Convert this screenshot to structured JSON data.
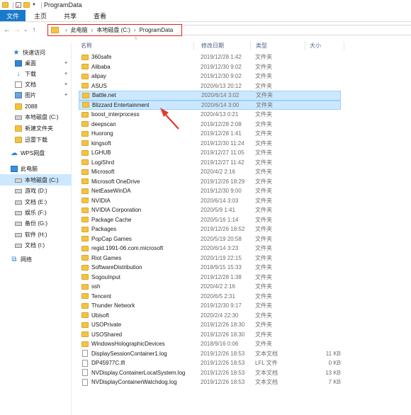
{
  "window": {
    "title": "ProgramData"
  },
  "ribbon": {
    "tabs": [
      "文件",
      "主页",
      "共享",
      "查看"
    ]
  },
  "address": {
    "crumbs": [
      "此电脑",
      "本地磁盘 (C:)",
      "ProgramData"
    ]
  },
  "columns": {
    "name": "名称",
    "date": "修改日期",
    "type": "类型",
    "size": "大小"
  },
  "sidebar": {
    "quick_access": "快速访问",
    "items": [
      {
        "label": "桌面",
        "icon": "desktop-icon",
        "pinned": true
      },
      {
        "label": "下载",
        "icon": "download-icon",
        "pinned": true
      },
      {
        "label": "文档",
        "icon": "document-icon",
        "pinned": true
      },
      {
        "label": "图片",
        "icon": "picture-icon",
        "pinned": true
      },
      {
        "label": "2088",
        "icon": "folder-icon"
      },
      {
        "label": "本地磁盘 (C:)",
        "icon": "drive-icon"
      },
      {
        "label": "新建文件夹",
        "icon": "folder-icon"
      },
      {
        "label": "迅雷下载",
        "icon": "folder-icon"
      }
    ],
    "wps": "WPS网盘",
    "this_pc": "此电脑",
    "drives": [
      {
        "label": "本地磁盘 (C:)",
        "selected": true
      },
      {
        "label": "游戏 (D:)"
      },
      {
        "label": "文档 (E:)"
      },
      {
        "label": "娱乐 (F:)"
      },
      {
        "label": "备份 (G:)"
      },
      {
        "label": "软件 (H:)"
      },
      {
        "label": "文档 (I:)"
      }
    ],
    "network": "网络"
  },
  "files": [
    {
      "name": "360safe",
      "date": "2019/12/28 1:42",
      "type": "文件夹",
      "size": "",
      "kind": "folder"
    },
    {
      "name": "Alibaba",
      "date": "2019/12/30 9:02",
      "type": "文件夹",
      "size": "",
      "kind": "folder"
    },
    {
      "name": "alipay",
      "date": "2019/12/30 9:02",
      "type": "文件夹",
      "size": "",
      "kind": "folder"
    },
    {
      "name": "ASUS",
      "date": "2020/6/13 20:12",
      "type": "文件夹",
      "size": "",
      "kind": "folder"
    },
    {
      "name": "Battle.net",
      "date": "2020/6/14 3:02",
      "type": "文件夹",
      "size": "",
      "kind": "folder",
      "selected": true
    },
    {
      "name": "Blizzard Entertainment",
      "date": "2020/6/14 3:00",
      "type": "文件夹",
      "size": "",
      "kind": "folder",
      "selected": true
    },
    {
      "name": "boost_interprocess",
      "date": "2020/4/13 0:21",
      "type": "文件夹",
      "size": "",
      "kind": "folder"
    },
    {
      "name": "deepscan",
      "date": "2019/12/28 2:08",
      "type": "文件夹",
      "size": "",
      "kind": "folder"
    },
    {
      "name": "Huorong",
      "date": "2019/12/28 1:41",
      "type": "文件夹",
      "size": "",
      "kind": "folder"
    },
    {
      "name": "kingsoft",
      "date": "2019/12/30 11:24",
      "type": "文件夹",
      "size": "",
      "kind": "folder"
    },
    {
      "name": "LGHUB",
      "date": "2019/12/27 11:05",
      "type": "文件夹",
      "size": "",
      "kind": "folder"
    },
    {
      "name": "LogiShrd",
      "date": "2019/12/27 11:42",
      "type": "文件夹",
      "size": "",
      "kind": "folder"
    },
    {
      "name": "Microsoft",
      "date": "2020/4/2 2:16",
      "type": "文件夹",
      "size": "",
      "kind": "folder"
    },
    {
      "name": "Microsoft OneDrive",
      "date": "2019/12/26 18:29",
      "type": "文件夹",
      "size": "",
      "kind": "folder"
    },
    {
      "name": "NetEaseWinDA",
      "date": "2019/12/30 9:00",
      "type": "文件夹",
      "size": "",
      "kind": "folder"
    },
    {
      "name": "NVIDIA",
      "date": "2020/6/14 3:03",
      "type": "文件夹",
      "size": "",
      "kind": "folder"
    },
    {
      "name": "NVIDIA Corporation",
      "date": "2020/5/9 1:41",
      "type": "文件夹",
      "size": "",
      "kind": "folder"
    },
    {
      "name": "Package Cache",
      "date": "2020/5/16 1:14",
      "type": "文件夹",
      "size": "",
      "kind": "folder"
    },
    {
      "name": "Packages",
      "date": "2019/12/26 18:52",
      "type": "文件夹",
      "size": "",
      "kind": "folder"
    },
    {
      "name": "PopCap Games",
      "date": "2020/5/19 20:58",
      "type": "文件夹",
      "size": "",
      "kind": "folder"
    },
    {
      "name": "regid.1991-06.com.microsoft",
      "date": "2020/6/14 3:23",
      "type": "文件夹",
      "size": "",
      "kind": "folder"
    },
    {
      "name": "Riot Games",
      "date": "2020/1/19 22:15",
      "type": "文件夹",
      "size": "",
      "kind": "folder"
    },
    {
      "name": "SoftwareDistribution",
      "date": "2018/9/15 15:33",
      "type": "文件夹",
      "size": "",
      "kind": "folder"
    },
    {
      "name": "SogouInput",
      "date": "2019/12/28 1:38",
      "type": "文件夹",
      "size": "",
      "kind": "folder"
    },
    {
      "name": "ssh",
      "date": "2020/4/2 2:16",
      "type": "文件夹",
      "size": "",
      "kind": "folder"
    },
    {
      "name": "Tencent",
      "date": "2020/6/5 2:31",
      "type": "文件夹",
      "size": "",
      "kind": "folder"
    },
    {
      "name": "Thunder Network",
      "date": "2019/12/30 9:17",
      "type": "文件夹",
      "size": "",
      "kind": "folder"
    },
    {
      "name": "Ubisoft",
      "date": "2020/2/4 22:30",
      "type": "文件夹",
      "size": "",
      "kind": "folder"
    },
    {
      "name": "USOPrivate",
      "date": "2019/12/26 18:30",
      "type": "文件夹",
      "size": "",
      "kind": "folder"
    },
    {
      "name": "USOShared",
      "date": "2019/12/26 18:30",
      "type": "文件夹",
      "size": "",
      "kind": "folder"
    },
    {
      "name": "WindowsHolographicDevices",
      "date": "2018/9/16 0:06",
      "type": "文件夹",
      "size": "",
      "kind": "folder"
    },
    {
      "name": "DisplaySessionContainer1.log",
      "date": "2019/12/26 18:53",
      "type": "文本文档",
      "size": "11 KB",
      "kind": "file"
    },
    {
      "name": "DP45977C.lfl",
      "date": "2019/12/26 18:53",
      "type": "LFL 文件",
      "size": "0 KB",
      "kind": "file"
    },
    {
      "name": "NVDisplay.ContainerLocalSystem.log",
      "date": "2019/12/26 18:53",
      "type": "文本文档",
      "size": "13 KB",
      "kind": "file"
    },
    {
      "name": "NVDisplayContainerWatchdog.log",
      "date": "2019/12/26 18:53",
      "type": "文本文档",
      "size": "7 KB",
      "kind": "file"
    }
  ],
  "annotation": {
    "color": "#e23a2e"
  }
}
